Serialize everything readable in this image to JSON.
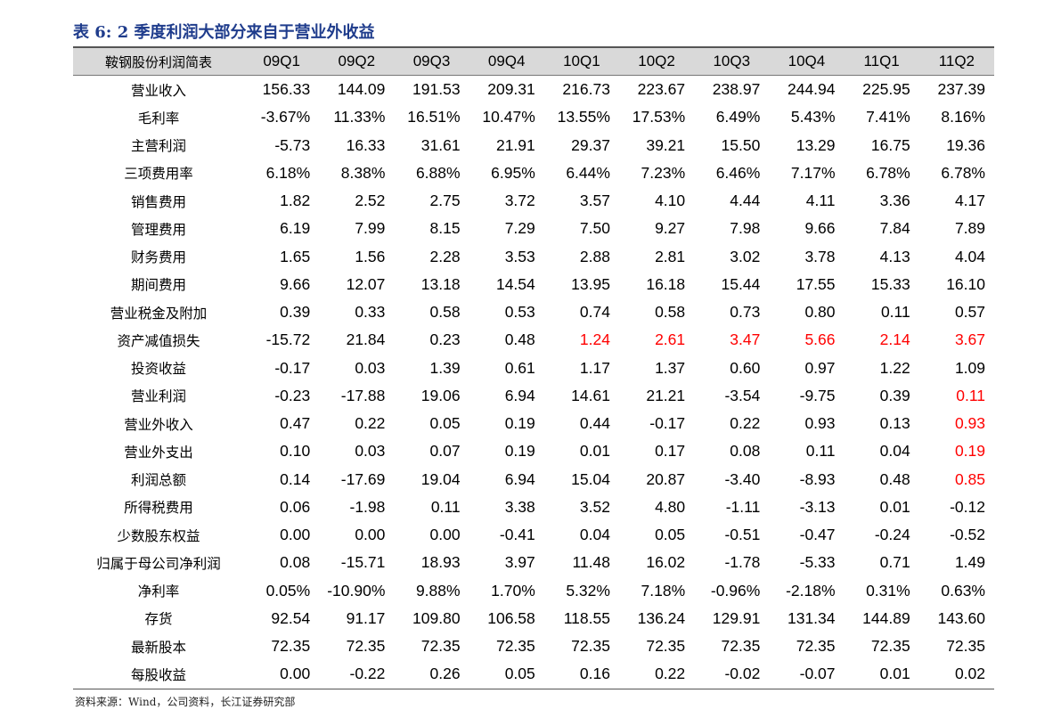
{
  "title": "表 6:  2 季度利润大部分来自于营业外收益",
  "table": {
    "corner_label": "鞍钢股份利润简表",
    "columns": [
      "09Q1",
      "09Q2",
      "09Q3",
      "09Q4",
      "10Q1",
      "10Q2",
      "10Q3",
      "10Q4",
      "11Q1",
      "11Q2"
    ],
    "rows": [
      {
        "label": "营业收入",
        "values": [
          "156.33",
          "144.09",
          "191.53",
          "209.31",
          "216.73",
          "223.67",
          "238.97",
          "244.94",
          "225.95",
          "237.39"
        ]
      },
      {
        "label": "毛利率",
        "values": [
          "-3.67%",
          "11.33%",
          "16.51%",
          "10.47%",
          "13.55%",
          "17.53%",
          "6.49%",
          "5.43%",
          "7.41%",
          "8.16%"
        ]
      },
      {
        "label": "主营利润",
        "values": [
          "-5.73",
          "16.33",
          "31.61",
          "21.91",
          "29.37",
          "39.21",
          "15.50",
          "13.29",
          "16.75",
          "19.36"
        ]
      },
      {
        "label": "三项费用率",
        "values": [
          "6.18%",
          "8.38%",
          "6.88%",
          "6.95%",
          "6.44%",
          "7.23%",
          "6.46%",
          "7.17%",
          "6.78%",
          "6.78%"
        ]
      },
      {
        "label": "销售费用",
        "values": [
          "1.82",
          "2.52",
          "2.75",
          "3.72",
          "3.57",
          "4.10",
          "4.44",
          "4.11",
          "3.36",
          "4.17"
        ]
      },
      {
        "label": "管理费用",
        "values": [
          "6.19",
          "7.99",
          "8.15",
          "7.29",
          "7.50",
          "9.27",
          "7.98",
          "9.66",
          "7.84",
          "7.89"
        ]
      },
      {
        "label": "财务费用",
        "values": [
          "1.65",
          "1.56",
          "2.28",
          "3.53",
          "2.88",
          "2.81",
          "3.02",
          "3.78",
          "4.13",
          "4.04"
        ]
      },
      {
        "label": "期间费用",
        "values": [
          "9.66",
          "12.07",
          "13.18",
          "14.54",
          "13.95",
          "16.18",
          "15.44",
          "17.55",
          "15.33",
          "16.10"
        ]
      },
      {
        "label": "营业税金及附加",
        "values": [
          "0.39",
          "0.33",
          "0.58",
          "0.53",
          "0.74",
          "0.58",
          "0.73",
          "0.80",
          "0.11",
          "0.57"
        ]
      },
      {
        "label": "资产减值损失",
        "values": [
          "-15.72",
          "21.84",
          "0.23",
          "0.48",
          "1.24",
          "2.61",
          "3.47",
          "5.66",
          "2.14",
          "3.67"
        ],
        "red": [
          4,
          5,
          6,
          7,
          8,
          9
        ]
      },
      {
        "label": "投资收益",
        "values": [
          "-0.17",
          "0.03",
          "1.39",
          "0.61",
          "1.17",
          "1.37",
          "0.60",
          "0.97",
          "1.22",
          "1.09"
        ]
      },
      {
        "label": "营业利润",
        "values": [
          "-0.23",
          "-17.88",
          "19.06",
          "6.94",
          "14.61",
          "21.21",
          "-3.54",
          "-9.75",
          "0.39",
          "0.11"
        ],
        "red": [
          9
        ]
      },
      {
        "label": "营业外收入",
        "values": [
          "0.47",
          "0.22",
          "0.05",
          "0.19",
          "0.44",
          "-0.17",
          "0.22",
          "0.93",
          "0.13",
          "0.93"
        ],
        "red": [
          9
        ]
      },
      {
        "label": "营业外支出",
        "values": [
          "0.10",
          "0.03",
          "0.07",
          "0.19",
          "0.01",
          "0.17",
          "0.08",
          "0.11",
          "0.04",
          "0.19"
        ],
        "red": [
          9
        ]
      },
      {
        "label": "利润总额",
        "values": [
          "0.14",
          "-17.69",
          "19.04",
          "6.94",
          "15.04",
          "20.87",
          "-3.40",
          "-8.93",
          "0.48",
          "0.85"
        ],
        "red": [
          9
        ]
      },
      {
        "label": "所得税费用",
        "values": [
          "0.06",
          "-1.98",
          "0.11",
          "3.38",
          "3.52",
          "4.80",
          "-1.11",
          "-3.13",
          "0.01",
          "-0.12"
        ]
      },
      {
        "label": "少数股东权益",
        "values": [
          "0.00",
          "0.00",
          "0.00",
          "-0.41",
          "0.04",
          "0.05",
          "-0.51",
          "-0.47",
          "-0.24",
          "-0.52"
        ]
      },
      {
        "label": "归属于母公司净利润",
        "values": [
          "0.08",
          "-15.71",
          "18.93",
          "3.97",
          "11.48",
          "16.02",
          "-1.78",
          "-5.33",
          "0.71",
          "1.49"
        ]
      },
      {
        "label": "净利率",
        "values": [
          "0.05%",
          "-10.90%",
          "9.88%",
          "1.70%",
          "5.32%",
          "7.18%",
          "-0.96%",
          "-2.18%",
          "0.31%",
          "0.63%"
        ]
      },
      {
        "label": "存货",
        "values": [
          "92.54",
          "91.17",
          "109.80",
          "106.58",
          "118.55",
          "136.24",
          "129.91",
          "131.34",
          "144.89",
          "143.60"
        ]
      },
      {
        "label": "最新股本",
        "values": [
          "72.35",
          "72.35",
          "72.35",
          "72.35",
          "72.35",
          "72.35",
          "72.35",
          "72.35",
          "72.35",
          "72.35"
        ]
      },
      {
        "label": "每股收益",
        "values": [
          "0.00",
          "-0.22",
          "0.26",
          "0.05",
          "0.16",
          "0.22",
          "-0.02",
          "-0.07",
          "0.01",
          "0.02"
        ]
      }
    ]
  },
  "colors": {
    "title": "#1f3c8c",
    "highlight": "#ff0000",
    "header_bg": "#d9d9d9"
  },
  "source": "资料来源：Wind，公司资料，长江证券研究部"
}
